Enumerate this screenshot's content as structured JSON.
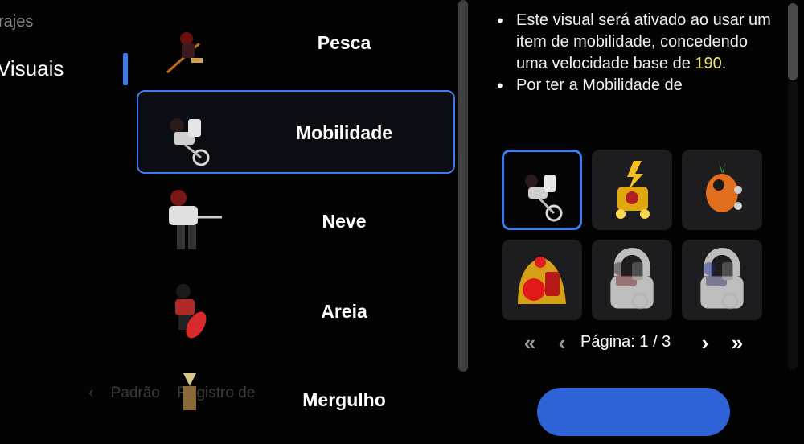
{
  "nav": {
    "sub_label": "rajes",
    "main_label": "Visuais"
  },
  "list": {
    "items": [
      {
        "label": "Pesca"
      },
      {
        "label": "Mobilidade"
      },
      {
        "label": "Neve"
      },
      {
        "label": "Areia"
      },
      {
        "label": "Mergulho"
      }
    ]
  },
  "description": {
    "bullet1_pre": "Este visual será ativado ao usar um item de mobilidade, concedendo uma velocidade base de ",
    "bullet1_value": "190",
    "bullet1_post": ".",
    "bullet2": "Por ter a Mobilidade de"
  },
  "grid": {
    "cells": [
      {
        "icon": "bike-rider-icon",
        "locked": false
      },
      {
        "icon": "golden-vehicle-icon",
        "locked": false
      },
      {
        "icon": "carrot-vehicle-icon",
        "locked": false
      },
      {
        "icon": "santa-sleigh-icon",
        "locked": false
      },
      {
        "icon": "locked-rider-icon",
        "locked": true
      },
      {
        "icon": "locked-blue-rider-icon",
        "locked": true
      }
    ]
  },
  "pager": {
    "label": "Página: 1 / 3"
  },
  "background_hints": {
    "faded_1": "Padrão",
    "faded_2": "Registro de"
  },
  "colors": {
    "accent": "#3d7bf0",
    "highlight": "#f2e36b",
    "panel": "#1d1d1f"
  }
}
